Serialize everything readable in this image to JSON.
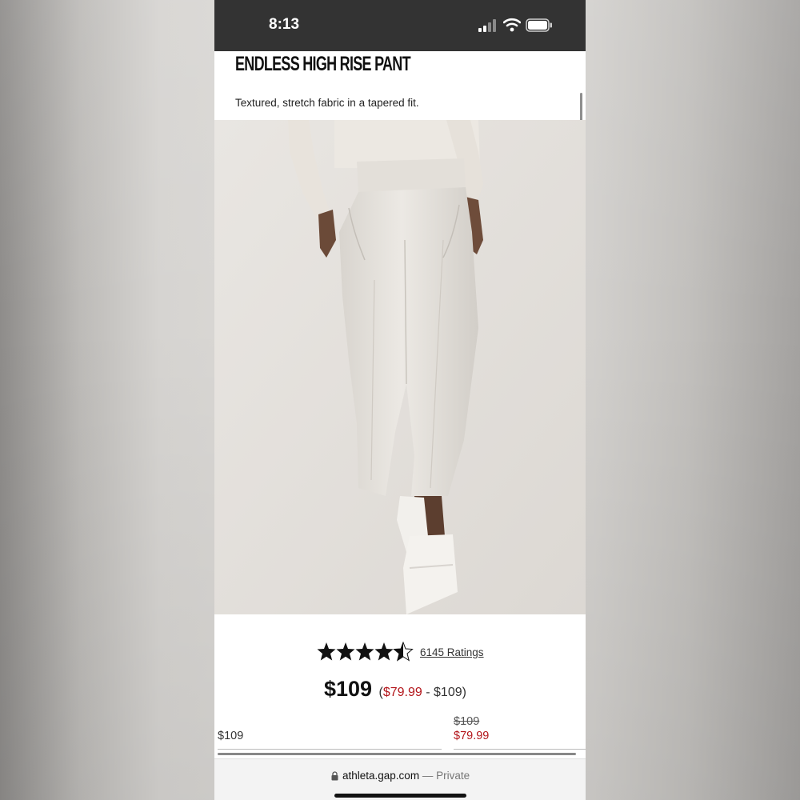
{
  "status_bar": {
    "time": "8:13"
  },
  "product": {
    "title": "ENDLESS HIGH RISE PANT",
    "subtitle": "Textured, stretch fabric in a tapered fit."
  },
  "carousel": {
    "dot_count": 9,
    "active_index": 0
  },
  "rating": {
    "stars": 4.5,
    "count_label": "6145 Ratings"
  },
  "price": {
    "main": "$109",
    "range_open": "(",
    "range_sale": "$79.99",
    "range_rest": " - $109)"
  },
  "variants": {
    "left_price": "$109",
    "right_original": "$109",
    "right_sale": "$79.99"
  },
  "browser": {
    "domain": "athleta.gap.com",
    "mode": " — Private"
  },
  "icons": [
    "signal-icon",
    "wifi-icon",
    "battery-icon",
    "star-icon",
    "lock-icon"
  ],
  "colors": {
    "sale_red": "#b3161b",
    "status_bar": "#333333"
  }
}
